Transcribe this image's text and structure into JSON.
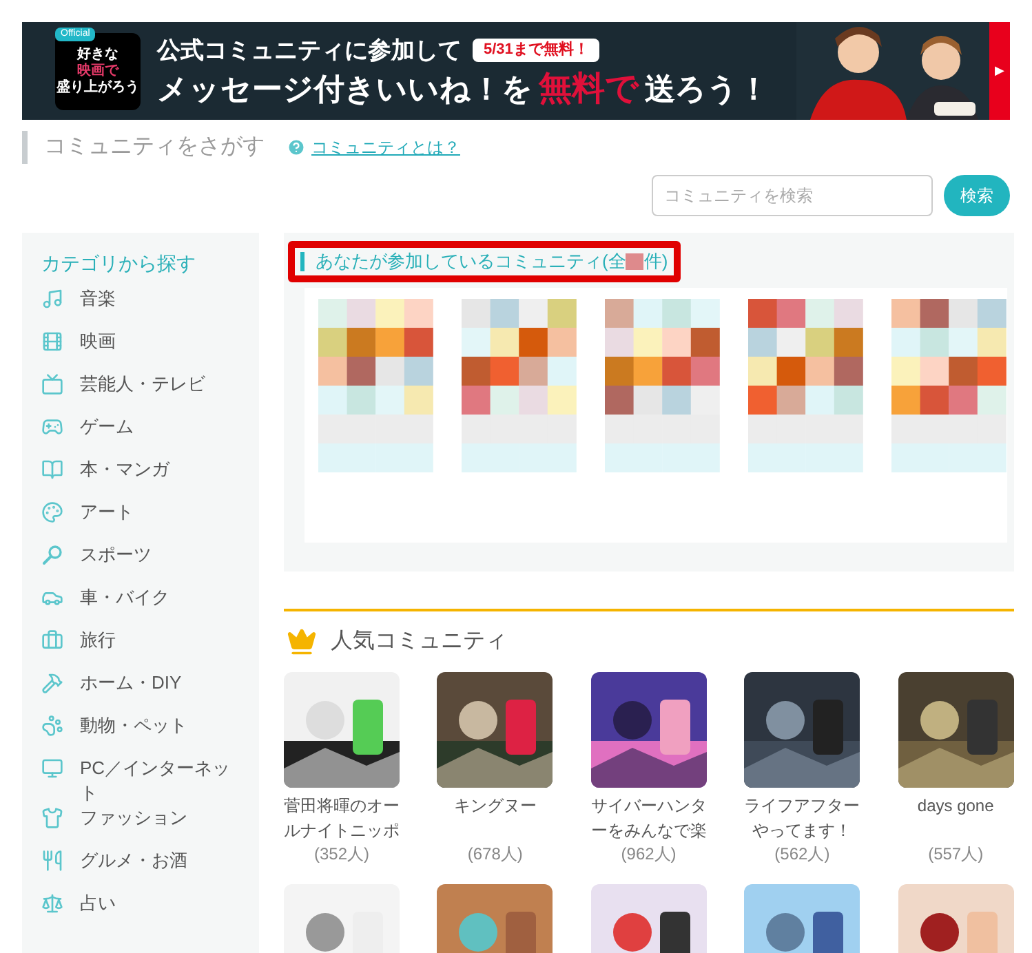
{
  "banner": {
    "logo_badge": "Official",
    "logo_lines": [
      "好きな",
      "映画で",
      "盛り上がろう"
    ],
    "headline": "公式コミュニティに参加して",
    "tag": "5/31まで無料！",
    "message_before": "メッセージ付きいいね！を",
    "message_highlight": "無料で",
    "message_after": "送ろう！",
    "arrow": "▶"
  },
  "page_title": "コミュニティをさがす",
  "help_link": "コミュニティとは？",
  "search": {
    "placeholder": "コミュニティを検索",
    "button": "検索"
  },
  "sidebar": {
    "title": "カテゴリから探す",
    "items": [
      {
        "label": "音楽",
        "kind": "music"
      },
      {
        "label": "映画",
        "kind": "film"
      },
      {
        "label": "芸能人・テレビ",
        "kind": "tv"
      },
      {
        "label": "ゲーム",
        "kind": "game"
      },
      {
        "label": "本・マンガ",
        "kind": "book"
      },
      {
        "label": "アート",
        "kind": "art"
      },
      {
        "label": "スポーツ",
        "kind": "sports"
      },
      {
        "label": "車・バイク",
        "kind": "car"
      },
      {
        "label": "旅行",
        "kind": "travel"
      },
      {
        "label": "ホーム・DIY",
        "kind": "diy"
      },
      {
        "label": "動物・ペット",
        "kind": "pet"
      },
      {
        "label": "PC／インターネット",
        "kind": "pc"
      },
      {
        "label": "ファッション",
        "kind": "fashion"
      },
      {
        "label": "グルメ・お酒",
        "kind": "food"
      },
      {
        "label": "占い",
        "kind": "fortune"
      }
    ]
  },
  "joined": {
    "title_before": "あなたが参加しているコミュニティ(全",
    "title_after": "件)",
    "count_redacted": true
  },
  "popular": {
    "title": "人気コミュニティ",
    "items": [
      {
        "kind": "community",
        "title": "菅田将暉のオールナイトニッポ",
        "count": "(352人)"
      },
      {
        "kind": "community",
        "title": "キングヌー",
        "count": "(678人)"
      },
      {
        "kind": "community",
        "title": "サイバーハンターをみんなで楽",
        "count": "(962人)"
      },
      {
        "kind": "community",
        "title": "ライフアフターやってます！",
        "count": "(562人)"
      },
      {
        "kind": "community",
        "title": "days gone",
        "count": "(557人)"
      },
      {
        "kind": "picture"
      },
      {
        "kind": "picture"
      },
      {
        "kind": "picture"
      },
      {
        "kind": "picture"
      },
      {
        "kind": "picture"
      }
    ]
  }
}
